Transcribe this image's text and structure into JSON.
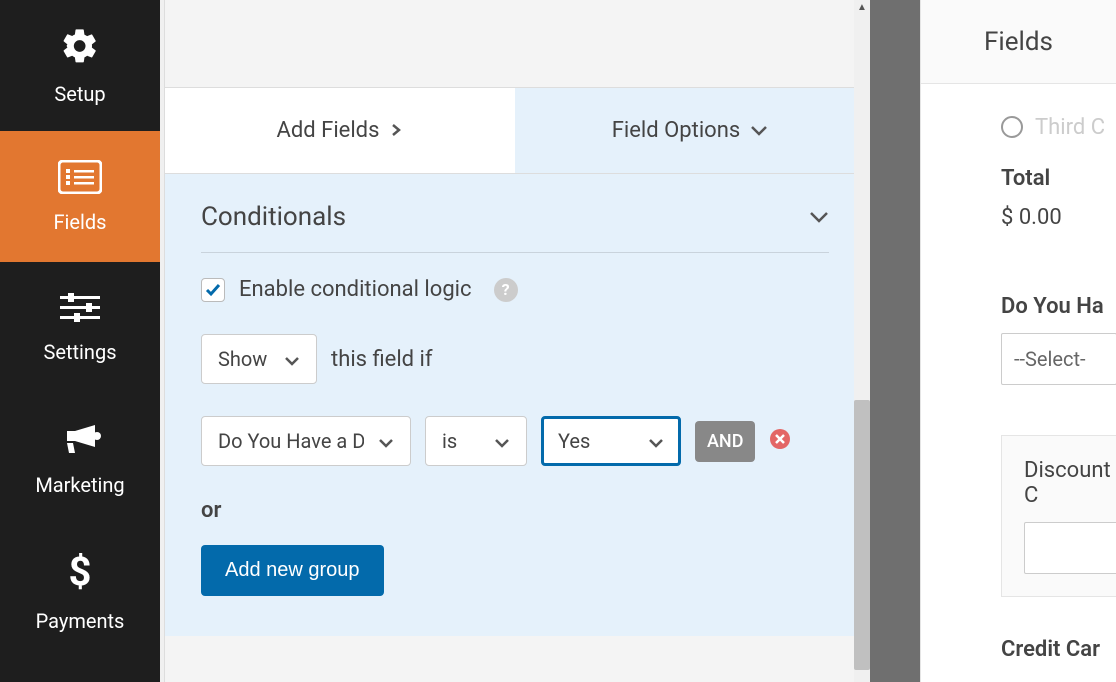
{
  "sidebar": {
    "items": [
      {
        "label": "Setup"
      },
      {
        "label": "Fields"
      },
      {
        "label": "Settings"
      },
      {
        "label": "Marketing"
      },
      {
        "label": "Payments"
      }
    ]
  },
  "tabs": {
    "add_fields": "Add Fields",
    "field_options": "Field Options"
  },
  "panel": {
    "title": "Conditionals",
    "enable_label": "Enable conditional logic",
    "show_label": "Show",
    "this_field_if": "this field if",
    "field_select": "Do You Have a D",
    "operator": "is",
    "value": "Yes",
    "and_label": "AND",
    "or_label": "or",
    "add_group": "Add new group"
  },
  "preview": {
    "header": "Fields",
    "radio_option": "Third C",
    "total_label": "Total",
    "total_value": "$ 0.00",
    "question_label": "Do You Ha",
    "select_placeholder": "--Select-",
    "discount_label": "Discount C",
    "credit_label": "Credit Car"
  }
}
